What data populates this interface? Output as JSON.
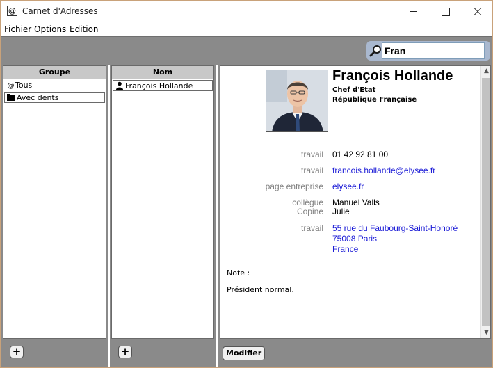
{
  "window": {
    "title": "Carnet d'Adresses",
    "icon_glyph": "@"
  },
  "menu": {
    "items": [
      "Fichier",
      "Options",
      "Edition"
    ]
  },
  "search": {
    "value": "Fran",
    "icon": "search-icon"
  },
  "groups": {
    "header": "Groupe",
    "items": [
      {
        "icon": "at-icon",
        "glyph": "@",
        "label": "Tous"
      },
      {
        "icon": "folder-icon",
        "label": "Avec dents",
        "selected": true
      }
    ],
    "add_label": "+"
  },
  "names": {
    "header": "Nom",
    "items": [
      {
        "icon": "person-icon",
        "label": "François Hollande",
        "selected": true
      }
    ],
    "add_label": "+"
  },
  "contact": {
    "name": "François Hollande",
    "job_title": "Chef d'Etat",
    "organization": "République Française",
    "fields": [
      {
        "label": "travail",
        "value": "01 42 92 81 00",
        "link": false
      },
      {
        "label": "travail",
        "value": "francois.hollande@elysee.fr",
        "link": true
      },
      {
        "label": "page entreprise",
        "value": "elysee.fr",
        "link": true
      }
    ],
    "relations": [
      {
        "label": "collègue",
        "value": "Manuel Valls"
      },
      {
        "label": "Copine",
        "value": "Julie"
      }
    ],
    "address": {
      "label": "travail",
      "lines": [
        "55 rue du Faubourg-Saint-Honoré",
        "75008 Paris",
        "France"
      ]
    },
    "note_label": "Note :",
    "note": "Président normal."
  },
  "buttons": {
    "modify": "Modifier"
  },
  "colors": {
    "toolbar_bg": "#8a8a8a",
    "link": "#1a1ad6",
    "label_gray": "#808080",
    "search_frame": "#a9b8cf"
  }
}
